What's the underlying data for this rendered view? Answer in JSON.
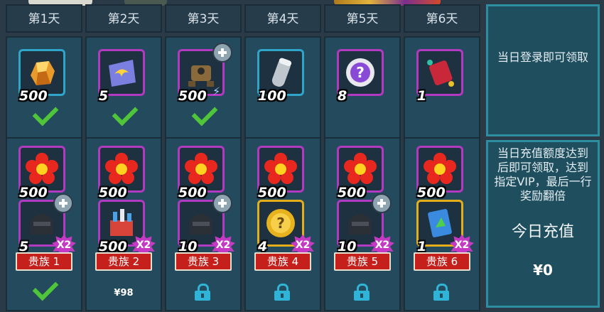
{
  "days": [
    {
      "header": "第1天",
      "login_reward": {
        "qty": "500",
        "icon": "amber-crystal-icon",
        "rarity": "blue",
        "status": "claimed"
      },
      "vip_rewards": [
        {
          "qty": "500",
          "icon": "red-flower-icon"
        },
        {
          "qty": "5",
          "icon": "dark-helmet-icon"
        }
      ],
      "vip_label": "贵族 1",
      "multiplier": "X2",
      "vip_status": "claimed"
    },
    {
      "header": "第2天",
      "login_reward": {
        "qty": "5",
        "icon": "winged-card-icon",
        "rarity": "purple",
        "status": "claimed"
      },
      "vip_rewards": [
        {
          "qty": "500",
          "icon": "red-flower-icon"
        },
        {
          "qty": "500",
          "icon": "firework-box-icon"
        }
      ],
      "vip_label": "贵族 2",
      "multiplier": "X2",
      "vip_status": "price",
      "vip_price": "¥98"
    },
    {
      "header": "第3天",
      "login_reward": {
        "qty": "500",
        "icon": "robot-mech-icon",
        "rarity": "purple",
        "status": "claimed"
      },
      "vip_rewards": [
        {
          "qty": "500",
          "icon": "red-flower-icon"
        },
        {
          "qty": "10",
          "icon": "dark-helmet-icon"
        }
      ],
      "vip_label": "贵族 3",
      "multiplier": "X2",
      "vip_status": "locked"
    },
    {
      "header": "第4天",
      "login_reward": {
        "qty": "100",
        "icon": "silver-canister-icon",
        "rarity": "blue",
        "status": "none"
      },
      "vip_rewards": [
        {
          "qty": "500",
          "icon": "red-flower-icon"
        },
        {
          "qty": "4",
          "icon": "gold-mystery-coin-icon"
        }
      ],
      "vip_label": "贵族 4",
      "multiplier": "X2",
      "vip_status": "locked"
    },
    {
      "header": "第5天",
      "login_reward": {
        "qty": "8",
        "icon": "purple-mystery-chip-icon",
        "rarity": "purple",
        "status": "none"
      },
      "vip_rewards": [
        {
          "qty": "500",
          "icon": "red-flower-icon"
        },
        {
          "qty": "10",
          "icon": "dark-helmet-icon"
        }
      ],
      "vip_label": "贵族 5",
      "multiplier": "X2",
      "vip_status": "locked"
    },
    {
      "header": "第6天",
      "login_reward": {
        "qty": "1",
        "icon": "red-scroll-icon",
        "rarity": "purple",
        "status": "none"
      },
      "vip_rewards": [
        {
          "qty": "500",
          "icon": "red-flower-icon"
        },
        {
          "qty": "1",
          "icon": "blue-skill-book-icon"
        }
      ],
      "vip_label": "贵族 6",
      "multiplier": "X2",
      "vip_status": "locked"
    }
  ],
  "side": {
    "login_text": "当日登录即可领取",
    "recharge_text": "当日充值额度达到后即可领取，达到指定VIP，最后一行奖励翻倍",
    "today_title": "今日充值",
    "today_value": "¥0"
  },
  "colors": {
    "rarity_blue": "#2fa6c9",
    "rarity_purple": "#b23ac0",
    "rarity_gold": "#e3ae1a",
    "check_green": "#4fc53a",
    "vip_red": "#c5201b",
    "lock_blue": "#2fb3d6"
  }
}
